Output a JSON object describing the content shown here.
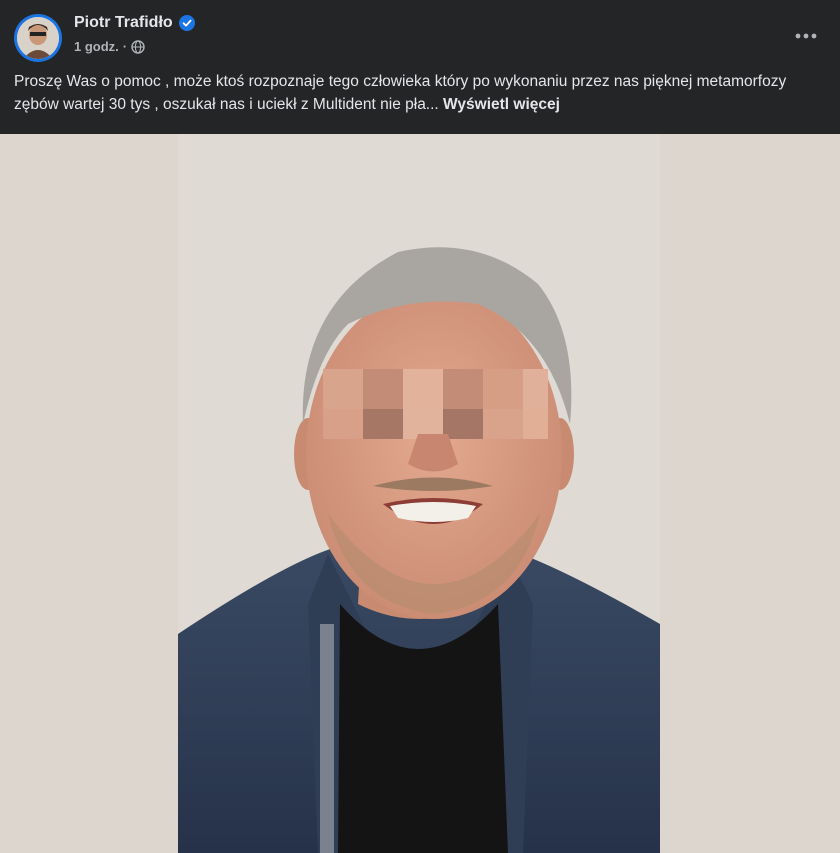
{
  "post": {
    "author": "Piotr Trafidło",
    "time": "1 godz.",
    "separator": "·",
    "text": "Proszę Was o pomoc , może ktoś rozpoznaje tego człowieka który po wykonaniu przez nas pięknej metamorfozy zębów wartej 30 tys , oszukał nas i uciekł z Multident nie pła...",
    "see_more": "Wyświetl więcej"
  },
  "icons": {
    "verified": "verified-badge-icon",
    "audience": "globe-icon",
    "more": "more-options-icon"
  },
  "colors": {
    "background": "#242526",
    "text": "#e4e6eb",
    "secondary_text": "#b0b3b8",
    "verified_blue": "#1b74e4"
  }
}
